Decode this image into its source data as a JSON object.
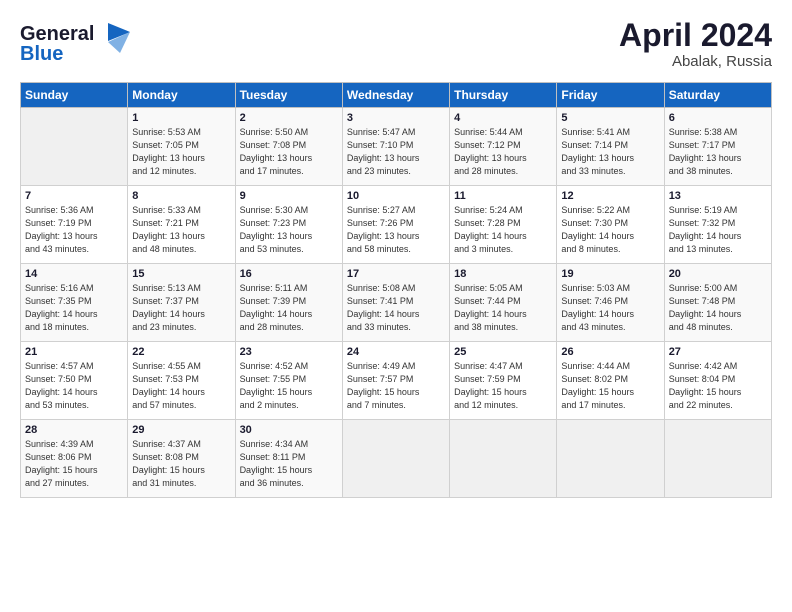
{
  "header": {
    "logo_line1": "General",
    "logo_line2": "Blue",
    "title": "April 2024",
    "location": "Abalak, Russia"
  },
  "columns": [
    "Sunday",
    "Monday",
    "Tuesday",
    "Wednesday",
    "Thursday",
    "Friday",
    "Saturday"
  ],
  "weeks": [
    [
      {
        "day": "",
        "info": ""
      },
      {
        "day": "1",
        "info": "Sunrise: 5:53 AM\nSunset: 7:05 PM\nDaylight: 13 hours\nand 12 minutes."
      },
      {
        "day": "2",
        "info": "Sunrise: 5:50 AM\nSunset: 7:08 PM\nDaylight: 13 hours\nand 17 minutes."
      },
      {
        "day": "3",
        "info": "Sunrise: 5:47 AM\nSunset: 7:10 PM\nDaylight: 13 hours\nand 23 minutes."
      },
      {
        "day": "4",
        "info": "Sunrise: 5:44 AM\nSunset: 7:12 PM\nDaylight: 13 hours\nand 28 minutes."
      },
      {
        "day": "5",
        "info": "Sunrise: 5:41 AM\nSunset: 7:14 PM\nDaylight: 13 hours\nand 33 minutes."
      },
      {
        "day": "6",
        "info": "Sunrise: 5:38 AM\nSunset: 7:17 PM\nDaylight: 13 hours\nand 38 minutes."
      }
    ],
    [
      {
        "day": "7",
        "info": "Sunrise: 5:36 AM\nSunset: 7:19 PM\nDaylight: 13 hours\nand 43 minutes."
      },
      {
        "day": "8",
        "info": "Sunrise: 5:33 AM\nSunset: 7:21 PM\nDaylight: 13 hours\nand 48 minutes."
      },
      {
        "day": "9",
        "info": "Sunrise: 5:30 AM\nSunset: 7:23 PM\nDaylight: 13 hours\nand 53 minutes."
      },
      {
        "day": "10",
        "info": "Sunrise: 5:27 AM\nSunset: 7:26 PM\nDaylight: 13 hours\nand 58 minutes."
      },
      {
        "day": "11",
        "info": "Sunrise: 5:24 AM\nSunset: 7:28 PM\nDaylight: 14 hours\nand 3 minutes."
      },
      {
        "day": "12",
        "info": "Sunrise: 5:22 AM\nSunset: 7:30 PM\nDaylight: 14 hours\nand 8 minutes."
      },
      {
        "day": "13",
        "info": "Sunrise: 5:19 AM\nSunset: 7:32 PM\nDaylight: 14 hours\nand 13 minutes."
      }
    ],
    [
      {
        "day": "14",
        "info": "Sunrise: 5:16 AM\nSunset: 7:35 PM\nDaylight: 14 hours\nand 18 minutes."
      },
      {
        "day": "15",
        "info": "Sunrise: 5:13 AM\nSunset: 7:37 PM\nDaylight: 14 hours\nand 23 minutes."
      },
      {
        "day": "16",
        "info": "Sunrise: 5:11 AM\nSunset: 7:39 PM\nDaylight: 14 hours\nand 28 minutes."
      },
      {
        "day": "17",
        "info": "Sunrise: 5:08 AM\nSunset: 7:41 PM\nDaylight: 14 hours\nand 33 minutes."
      },
      {
        "day": "18",
        "info": "Sunrise: 5:05 AM\nSunset: 7:44 PM\nDaylight: 14 hours\nand 38 minutes."
      },
      {
        "day": "19",
        "info": "Sunrise: 5:03 AM\nSunset: 7:46 PM\nDaylight: 14 hours\nand 43 minutes."
      },
      {
        "day": "20",
        "info": "Sunrise: 5:00 AM\nSunset: 7:48 PM\nDaylight: 14 hours\nand 48 minutes."
      }
    ],
    [
      {
        "day": "21",
        "info": "Sunrise: 4:57 AM\nSunset: 7:50 PM\nDaylight: 14 hours\nand 53 minutes."
      },
      {
        "day": "22",
        "info": "Sunrise: 4:55 AM\nSunset: 7:53 PM\nDaylight: 14 hours\nand 57 minutes."
      },
      {
        "day": "23",
        "info": "Sunrise: 4:52 AM\nSunset: 7:55 PM\nDaylight: 15 hours\nand 2 minutes."
      },
      {
        "day": "24",
        "info": "Sunrise: 4:49 AM\nSunset: 7:57 PM\nDaylight: 15 hours\nand 7 minutes."
      },
      {
        "day": "25",
        "info": "Sunrise: 4:47 AM\nSunset: 7:59 PM\nDaylight: 15 hours\nand 12 minutes."
      },
      {
        "day": "26",
        "info": "Sunrise: 4:44 AM\nSunset: 8:02 PM\nDaylight: 15 hours\nand 17 minutes."
      },
      {
        "day": "27",
        "info": "Sunrise: 4:42 AM\nSunset: 8:04 PM\nDaylight: 15 hours\nand 22 minutes."
      }
    ],
    [
      {
        "day": "28",
        "info": "Sunrise: 4:39 AM\nSunset: 8:06 PM\nDaylight: 15 hours\nand 27 minutes."
      },
      {
        "day": "29",
        "info": "Sunrise: 4:37 AM\nSunset: 8:08 PM\nDaylight: 15 hours\nand 31 minutes."
      },
      {
        "day": "30",
        "info": "Sunrise: 4:34 AM\nSunset: 8:11 PM\nDaylight: 15 hours\nand 36 minutes."
      },
      {
        "day": "",
        "info": ""
      },
      {
        "day": "",
        "info": ""
      },
      {
        "day": "",
        "info": ""
      },
      {
        "day": "",
        "info": ""
      }
    ]
  ]
}
